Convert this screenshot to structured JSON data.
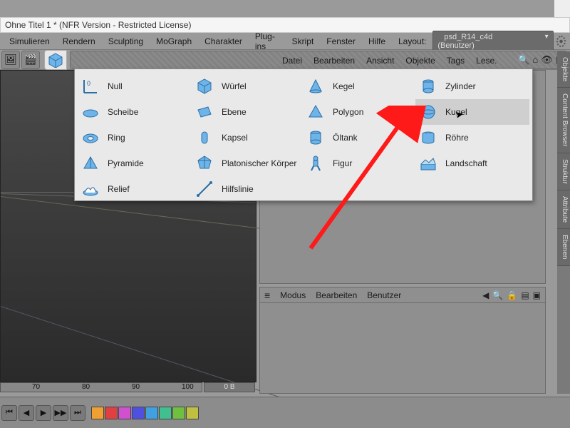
{
  "window": {
    "title": "Ohne Titel 1 * (NFR Version - Restricted License)"
  },
  "mainmenu": {
    "items": [
      "Simulieren",
      "Rendern",
      "Sculpting",
      "MoGraph",
      "Charakter",
      "Plug-ins",
      "Skript",
      "Fenster",
      "Hilfe"
    ],
    "layout_label": "Layout:",
    "layout_value": "psd_R14_c4d (Benutzer)"
  },
  "objects_menu": {
    "items": [
      "Datei",
      "Bearbeiten",
      "Ansicht",
      "Objekte",
      "Tags",
      "Lese."
    ]
  },
  "attribute_menu": {
    "items": [
      "Modus",
      "Bearbeiten",
      "Benutzer"
    ]
  },
  "popup": {
    "col1": [
      {
        "icon": "null-axis",
        "label": "Null"
      },
      {
        "icon": "disc",
        "label": "Scheibe"
      },
      {
        "icon": "torus",
        "label": "Ring"
      },
      {
        "icon": "pyramid",
        "label": "Pyramide"
      },
      {
        "icon": "relief",
        "label": "Relief"
      }
    ],
    "col2": [
      {
        "icon": "cube",
        "label": "Würfel"
      },
      {
        "icon": "plane",
        "label": "Ebene"
      },
      {
        "icon": "capsule",
        "label": "Kapsel"
      },
      {
        "icon": "platonic",
        "label": "Platonischer Körper"
      },
      {
        "icon": "guide",
        "label": "Hilfslinie"
      }
    ],
    "col3": [
      {
        "icon": "cone",
        "label": "Kegel"
      },
      {
        "icon": "polygon",
        "label": "Polygon"
      },
      {
        "icon": "oiltank",
        "label": "Öltank"
      },
      {
        "icon": "figure",
        "label": "Figur"
      }
    ],
    "col4": [
      {
        "icon": "cylinder",
        "label": "Zylinder"
      },
      {
        "icon": "sphere",
        "label": "Kugel",
        "hover": true
      },
      {
        "icon": "tube",
        "label": "Röhre"
      },
      {
        "icon": "landscape",
        "label": "Landschaft"
      }
    ]
  },
  "ruler": {
    "ticks": [
      "70",
      "80",
      "90",
      "100"
    ],
    "bytes": "0 B"
  },
  "sidetabs": [
    "Objekte",
    "Content Browser",
    "Struktur",
    "Attribute",
    "Ebenen"
  ],
  "colors": {
    "chips": [
      "#f0a030",
      "#e04040",
      "#d050d0",
      "#5050e0",
      "#40a0e0",
      "#40c090",
      "#70c040",
      "#c0c040"
    ]
  }
}
